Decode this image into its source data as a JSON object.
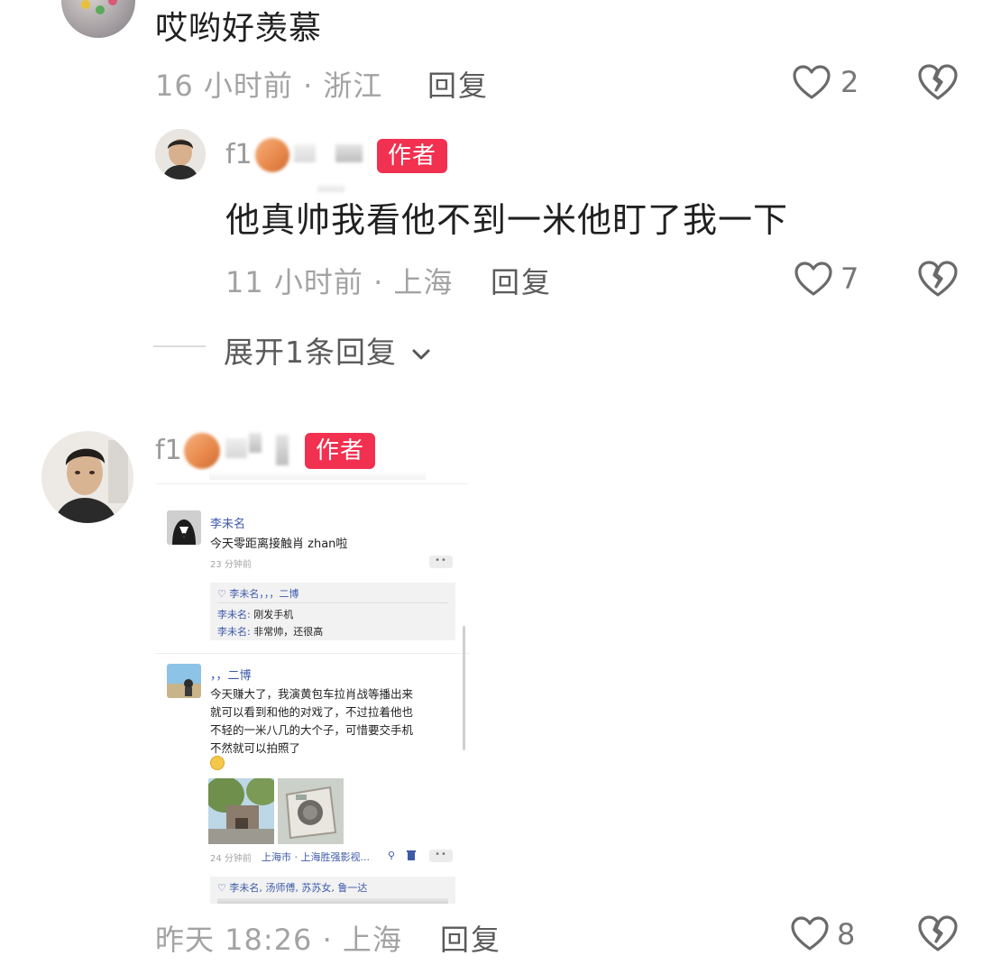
{
  "top_comment": {
    "text": "哎哟好羡慕",
    "meta": "16 小时前 · 浙江",
    "reply_label": "回复",
    "likes": "2"
  },
  "reply_1": {
    "name": "f1",
    "badge": "作者",
    "text": "他真帅我看他不到一米他盯了我一下",
    "meta": "11 小时前 · 上海",
    "reply_label": "回复",
    "likes": "7"
  },
  "expand_label": "展开1条回复",
  "comment_2": {
    "name": "f1",
    "badge": "作者",
    "meta": "昨天 18:26 · 上海",
    "reply_label": "回复",
    "likes": "8",
    "screenshot": {
      "post1": {
        "user": "李未名",
        "text": "今天零距离接触肖 zhan啦",
        "time": "23 分钟前",
        "likes_line": "李未名，，，二博",
        "reply1_user": "李未名:",
        "reply1_text": "刚发手机",
        "reply2_user": "李未名:",
        "reply2_text": "非常帅，还很高"
      },
      "post2": {
        "user": "，，二博",
        "text_l1": "今天赚大了，我演黄包车拉肖战等播出来",
        "text_l2": "就可以看到和他的对戏了，不过拉着他也",
        "text_l3": "不轻的一米八几的大个子，可惜要交手机",
        "text_l4": "不然就可以拍照了",
        "time": "24 分钟前",
        "location": "上海市 · 上海胜强影视...",
        "likes_line": "李未名, 汤师傅, 苏苏女, 鲁一达"
      }
    }
  },
  "colors": {
    "badge": "#f2304f",
    "meta_gray": "#a3a3a3",
    "link_blue": "#3d5aa8"
  }
}
